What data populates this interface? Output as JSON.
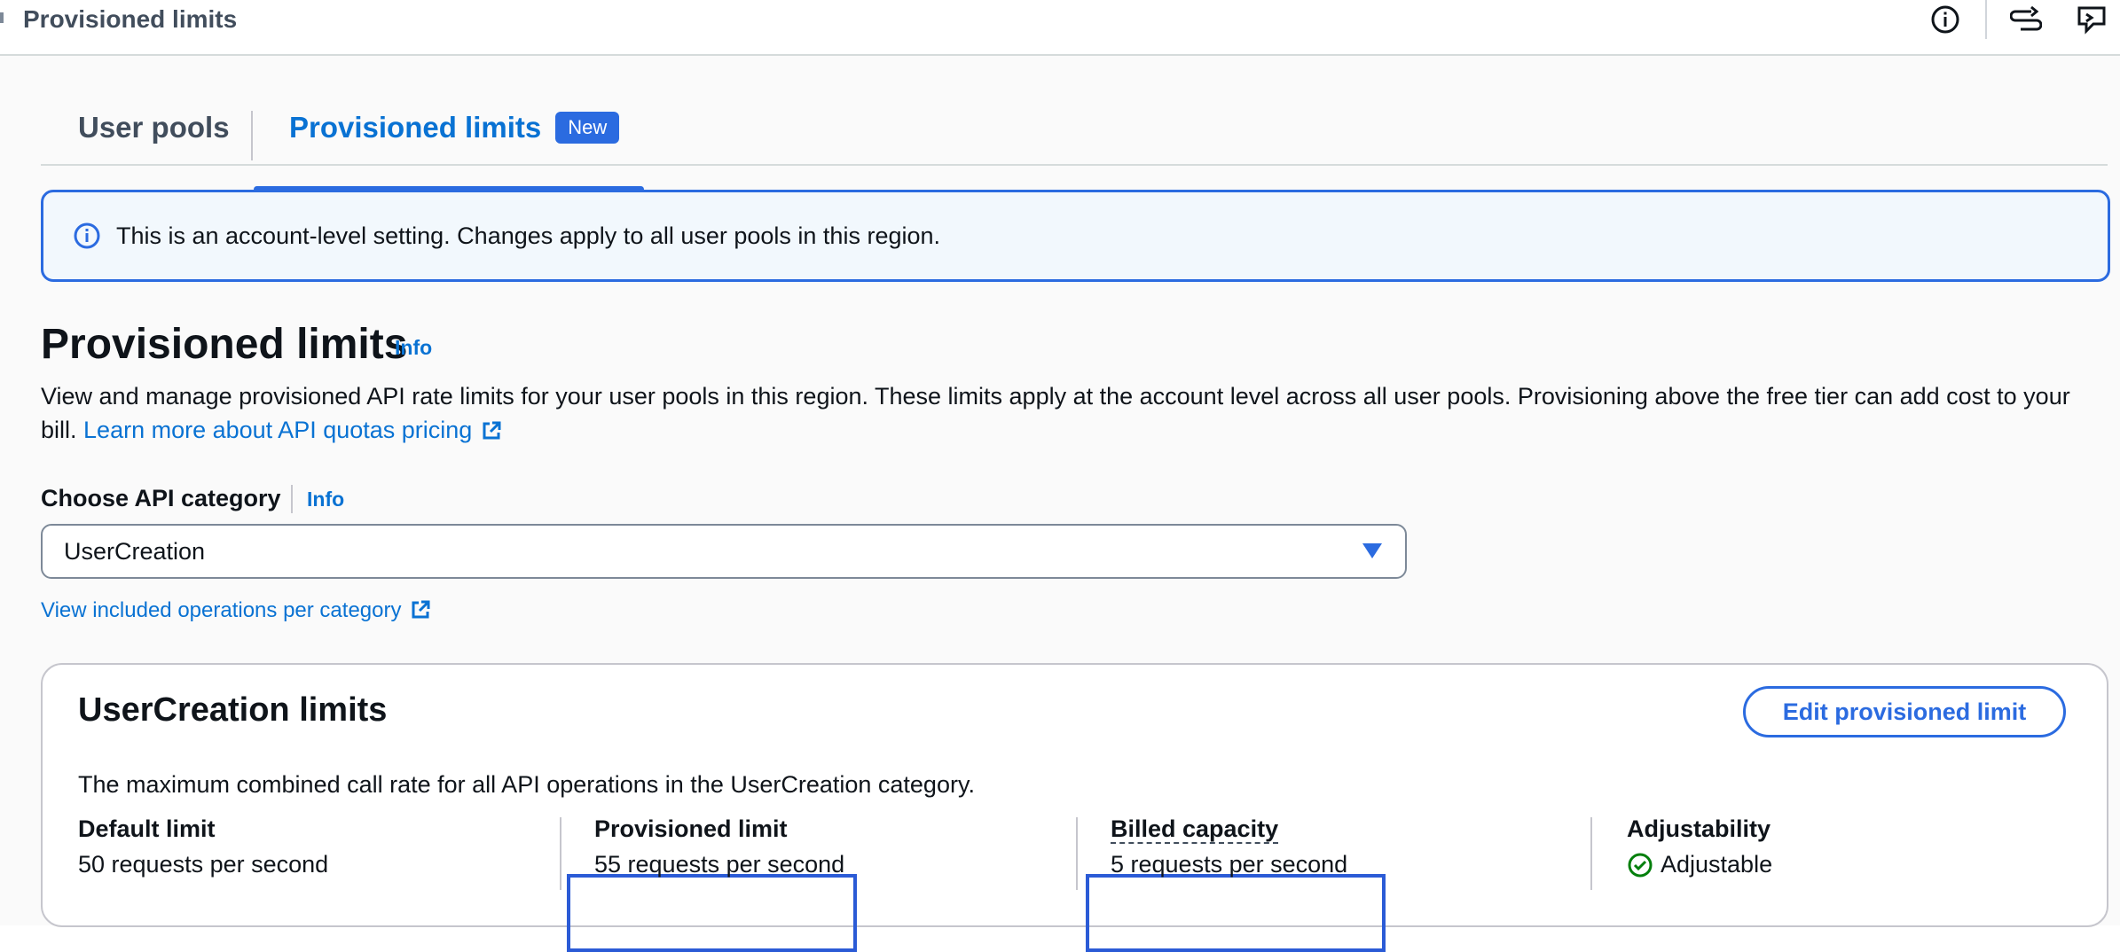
{
  "topbar": {
    "title": "Provisioned limits",
    "icons": [
      "info-icon",
      "split-panel-icon",
      "feedback-icon"
    ]
  },
  "tabs": [
    {
      "label": "User pools",
      "active": false
    },
    {
      "label": "Provisioned limits",
      "active": true,
      "badge": "New"
    }
  ],
  "alert": {
    "text": "This is an account-level setting. Changes apply to all user pools in this region."
  },
  "page": {
    "title": "Provisioned limits",
    "info_label": "Info",
    "description": "View and manage provisioned API rate limits for your user pools in this region. These limits apply at the account level across all user pools. Provisioning above the free tier can add cost to your bill.",
    "pricing_link": "Learn more about API quotas pricing"
  },
  "api_category": {
    "label": "Choose API category",
    "info_label": "Info",
    "selected": "UserCreation",
    "operations_link": "View included operations per category"
  },
  "limits_card": {
    "title": "UserCreation limits",
    "edit_button": "Edit provisioned limit",
    "description": "The maximum combined call rate for all API operations in the UserCreation category.",
    "stats": {
      "default_limit": {
        "label": "Default limit",
        "value": "50 requests per second"
      },
      "provisioned_limit": {
        "label": "Provisioned limit",
        "value": "55 requests per second"
      },
      "billed_capacity": {
        "label": "Billed capacity",
        "value": "5 requests per second"
      },
      "adjustability": {
        "label": "Adjustability",
        "value": "Adjustable"
      }
    }
  },
  "colors": {
    "accent": "#2b6be0",
    "link": "#0972d3",
    "success": "#037f0c",
    "alert_bg": "#f2f8fd"
  }
}
